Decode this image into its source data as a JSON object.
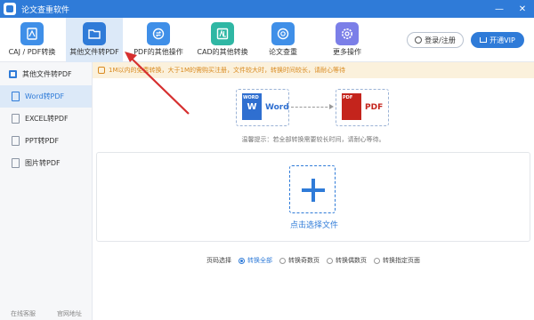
{
  "app": {
    "title": "论文查重软件"
  },
  "window_controls": {
    "minimize": "—",
    "close": "✕"
  },
  "toolbar": {
    "tools": [
      {
        "label": "CAJ / PDF转换",
        "icon": "caj-pdf-icon",
        "color": "#3f8fe8"
      },
      {
        "label": "其他文件转PDF",
        "icon": "folder-icon",
        "color": "#2f7bd8"
      },
      {
        "label": "PDF的其他操作",
        "icon": "convert-icon",
        "color": "#3f8fe8"
      },
      {
        "label": "CAD的其他转换",
        "icon": "cad-icon",
        "color": "#2fb7a4"
      },
      {
        "label": "论文查重",
        "icon": "check-icon",
        "color": "#3f8fe8"
      },
      {
        "label": "更多操作",
        "icon": "gear-icon",
        "color": "#7b7fe8"
      }
    ],
    "login_label": "登录/注册",
    "vip_label": "开通VIP"
  },
  "sidebar": {
    "header": "其他文件转PDF",
    "items": [
      {
        "label": "Word转PDF",
        "active": true
      },
      {
        "label": "EXCEL转PDF",
        "active": false
      },
      {
        "label": "PPT转PDF",
        "active": false
      },
      {
        "label": "图片转PDF",
        "active": false
      }
    ],
    "footer": {
      "service": "在线客服",
      "website": "官网地址"
    }
  },
  "notice": {
    "text": "1M以内的免费转换，大于1M的需购买注册，文件较大时，转换时间较长，请耐心等待"
  },
  "diagram": {
    "source_badge": "WORD",
    "source_letter": "W",
    "source_name": "Word",
    "target_badge": "PDF",
    "target_name": "PDF"
  },
  "tip": {
    "text": "温馨提示：若全部转换需要较长时间，请耐心等待。"
  },
  "upload": {
    "label": "点击选择文件"
  },
  "page_select": {
    "label": "页码选择",
    "options": [
      {
        "label": "转换全部",
        "selected": true
      },
      {
        "label": "转换奇数页",
        "selected": false
      },
      {
        "label": "转换偶数页",
        "selected": false
      },
      {
        "label": "转换指定页面",
        "selected": false
      }
    ]
  },
  "colors": {
    "accent": "#2f7bd8",
    "annotation_arrow": "#d62f2f"
  }
}
